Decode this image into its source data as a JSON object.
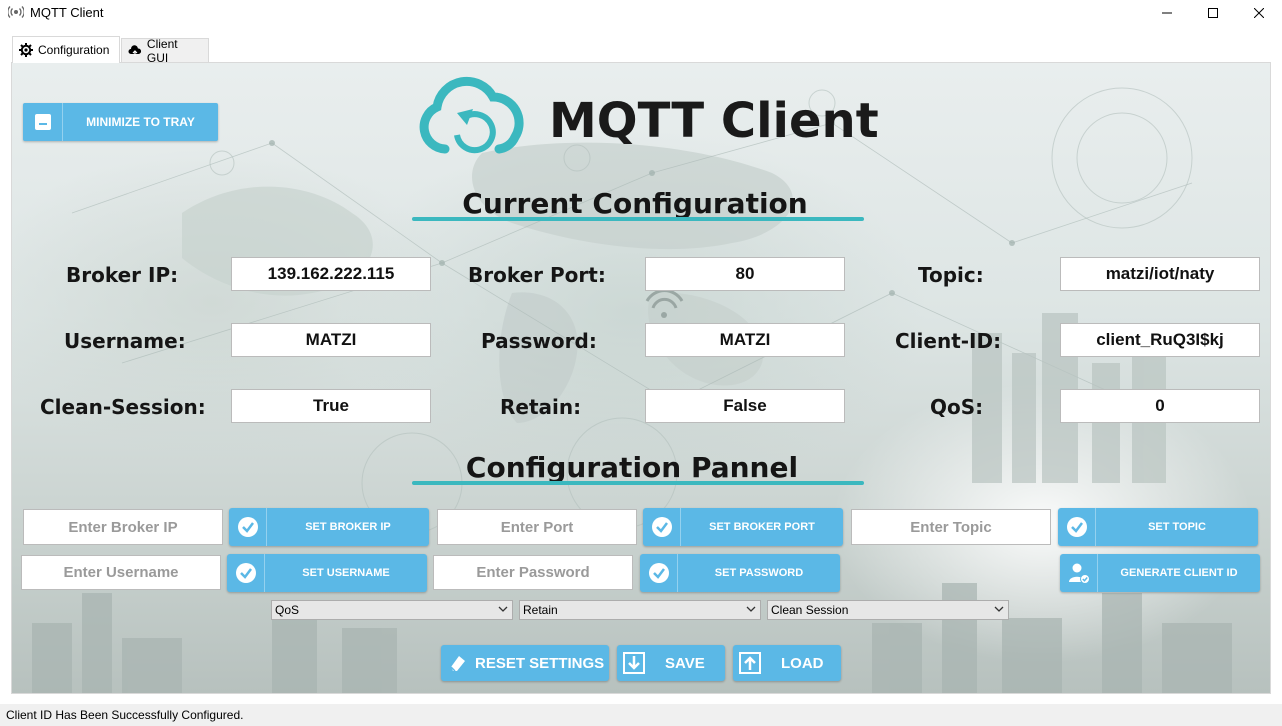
{
  "window": {
    "title": "MQTT Client",
    "icon": "broadcast-icon"
  },
  "tabs": [
    {
      "label": "Configuration",
      "icon": "gear-icon",
      "active": true
    },
    {
      "label": "Client GUI",
      "icon": "cloud-icon",
      "active": false
    }
  ],
  "tray_button": {
    "label": "MINIMIZE TO TRAY",
    "icon": "minus-icon"
  },
  "logo": {
    "text": "MQTT Client",
    "icon": "cloud-sync-icon"
  },
  "current_config": {
    "title": "Current Configuration",
    "broker_ip": {
      "label": "Broker IP:",
      "value": "139.162.222.115"
    },
    "broker_port": {
      "label": "Broker Port:",
      "value": "80"
    },
    "topic": {
      "label": "Topic:",
      "value": "matzi/iot/naty"
    },
    "username": {
      "label": "Username:",
      "value": "MATZI"
    },
    "password": {
      "label": "Password:",
      "value": "MATZI"
    },
    "client_id": {
      "label": "Client-ID:",
      "value": "client_RuQ3I$kj"
    },
    "clean_session": {
      "label": "Clean-Session:",
      "value": "True"
    },
    "retain": {
      "label": "Retain:",
      "value": "False"
    },
    "qos": {
      "label": "QoS:",
      "value": "0"
    }
  },
  "config_panel": {
    "title": "Configuration Pannel",
    "broker_ip_placeholder": "Enter Broker IP",
    "set_broker_ip": "SET BROKER IP",
    "port_placeholder": "Enter Port",
    "set_broker_port": "SET BROKER PORT",
    "topic_placeholder": "Enter Topic",
    "set_topic": "SET TOPIC",
    "username_placeholder": "Enter Username",
    "set_username": "SET USERNAME",
    "password_placeholder": "Enter Password",
    "set_password": "SET PASSWORD",
    "generate_client_id": "GENERATE CLIENT ID",
    "qos_select": "QoS",
    "retain_select": "Retain",
    "clean_session_select": "Clean Session"
  },
  "actions": {
    "reset": "RESET SETTINGS",
    "save": "SAVE",
    "load": "LOAD"
  },
  "status": "Client ID Has Been Successfully Configured.",
  "colors": {
    "accent": "#5bb8e6",
    "teal": "#3bb8bf"
  }
}
